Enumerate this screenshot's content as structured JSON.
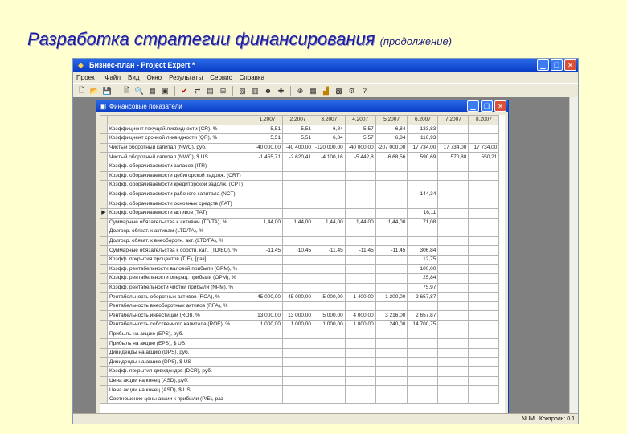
{
  "slide": {
    "title": "Разработка стратегии финансирования",
    "subtitle": "(продолжение)"
  },
  "app": {
    "title": "Бизнес-план - Project Expert *",
    "menu": [
      "Проект",
      "Файл",
      "Вид",
      "Окно",
      "Результаты",
      "Сервис",
      "Справка"
    ],
    "status_right": [
      "NUM",
      "Контроль: 0.1"
    ]
  },
  "child": {
    "title": "Финансовые показатели"
  },
  "grid": {
    "columns": [
      "1.2007",
      "2.2007",
      "3.2007",
      "4.2007",
      "5.2007",
      "6.2007",
      "7.2007",
      "8.2007"
    ],
    "rows": [
      {
        "label": "Коэффициент текущей ликвидности (CR), %",
        "values": [
          "5,51",
          "5,51",
          "6,84",
          "5,57",
          "6,84",
          "133,83",
          "",
          ""
        ]
      },
      {
        "label": "Коэффициент срочной ликвидности (QR), %",
        "values": [
          "5,51",
          "5,51",
          "6,84",
          "5,57",
          "6,84",
          "116,93",
          "",
          ""
        ]
      },
      {
        "label": "Чистый оборотный капитал (NWC), руб.",
        "values": [
          "-40 000,00",
          "-40 400,00",
          "-120 000,00",
          "-40 000,00",
          "-207 000,00",
          "17 734,00",
          "17 734,00",
          "17 734,00"
        ]
      },
      {
        "label": "Чистый оборотный капитал (NWC), $ US",
        "values": [
          "-1 455,71",
          "-2 620,41",
          "-4 100,16",
          "-5 442,8",
          "-6 68,56",
          "590,69",
          "570,88",
          "550,21"
        ]
      },
      {
        "label": "Коэфф. оборачиваемости запасов (ITR)",
        "values": [
          "",
          "",
          "",
          "",
          "",
          "",
          "",
          ""
        ]
      },
      {
        "label": "Коэфф. оборачиваемости дебиторской задолж. (CRT)",
        "values": [
          "",
          "",
          "",
          "",
          "",
          "",
          "",
          ""
        ]
      },
      {
        "label": "Коэфф. оборачиваемости кредиторской задолж. (CPT)",
        "values": [
          "",
          "",
          "",
          "",
          "",
          "",
          "",
          ""
        ]
      },
      {
        "label": "Коэфф. оборачиваемости рабочего капитала (NCT)",
        "values": [
          "",
          "",
          "",
          "",
          "",
          "144,34",
          "",
          ""
        ]
      },
      {
        "label": "Коэфф. оборачиваемости основных средств (FAT)",
        "values": [
          "",
          "",
          "",
          "",
          "",
          "",
          "",
          ""
        ]
      },
      {
        "label": "Коэфф. оборачиваемости активов (TAT)",
        "values": [
          "",
          "",
          "",
          "",
          "",
          "16,11",
          "",
          ""
        ],
        "indicator": "▶"
      },
      {
        "label": "Суммарные обязательства к активам (TD/TA), %",
        "values": [
          "1,44,00",
          "1,44,00",
          "1,44,00",
          "1,44,00",
          "1,44,00",
          "71,08",
          "",
          ""
        ]
      },
      {
        "label": "Долгоср. обязат. к активам (LTD/TA), %",
        "values": [
          "",
          "",
          "",
          "",
          "",
          "",
          "",
          ""
        ]
      },
      {
        "label": "Долгоср. обязат. к внеоборотн. акт. (LTD/FA), %",
        "values": [
          "",
          "",
          "",
          "",
          "",
          "",
          "",
          ""
        ]
      },
      {
        "label": "Суммарные обязательства к собств. кап. (TD/EQ), %",
        "values": [
          "-11,45",
          "-10,45",
          "-11,45",
          "-11,45",
          "-11,45",
          "306,84",
          "",
          ""
        ]
      },
      {
        "label": "Коэфф. покрытия процентов (TIE), [раз]",
        "values": [
          "",
          "",
          "",
          "",
          "",
          "12,75",
          "",
          ""
        ]
      },
      {
        "label": "Коэфф. рентабельности валовой прибыли (GPM), %",
        "values": [
          "",
          "",
          "",
          "",
          "",
          "100,00",
          "",
          ""
        ]
      },
      {
        "label": "Коэфф. рентабельности операц. прибыли (OPM), %",
        "values": [
          "",
          "",
          "",
          "",
          "",
          "25,84",
          "",
          ""
        ]
      },
      {
        "label": "Коэфф. рентабельности чистой прибыли (NPM), %",
        "values": [
          "",
          "",
          "",
          "",
          "",
          "75,97",
          "",
          ""
        ]
      },
      {
        "label": "Рентабельность оборотных активов (RCA), %",
        "values": [
          "-45 000,00",
          "-45 000,00",
          "-5 000,00",
          "-1 400,00",
          "-1 200,00",
          "2 657,87",
          "",
          ""
        ]
      },
      {
        "label": "Рентабельность внеоборотных активов (RFA), %",
        "values": [
          "",
          "",
          "",
          "",
          "",
          "",
          "",
          ""
        ]
      },
      {
        "label": "Рентабельность инвестиций (ROI), %",
        "values": [
          "13 000,00",
          "13 000,00",
          "5 000,00",
          "4 000,00",
          "3 216,00",
          "2 657,87",
          "",
          ""
        ]
      },
      {
        "label": "Рентабельность собственного капитала (ROE), %",
        "values": [
          "1 000,00",
          "1 000,00",
          "1 000,00",
          "1 000,00",
          "240,00",
          "14 700,75",
          "",
          ""
        ]
      },
      {
        "label": "Прибыль на акцию (EPS), руб.",
        "values": [
          "",
          "",
          "",
          "",
          "",
          "",
          "",
          ""
        ]
      },
      {
        "label": "Прибыль на акцию (EPS), $ US",
        "values": [
          "",
          "",
          "",
          "",
          "",
          "",
          "",
          ""
        ]
      },
      {
        "label": "Дивиденды на акцию (DPS), руб.",
        "values": [
          "",
          "",
          "",
          "",
          "",
          "",
          "",
          ""
        ]
      },
      {
        "label": "Дивиденды на акцию (DPS), $ US",
        "values": [
          "",
          "",
          "",
          "",
          "",
          "",
          "",
          ""
        ]
      },
      {
        "label": "Коэфф. покрытия дивидендов (DCR), руб.",
        "values": [
          "",
          "",
          "",
          "",
          "",
          "",
          "",
          ""
        ]
      },
      {
        "label": "Цена акции на конец (ASD), руб.",
        "values": [
          "",
          "",
          "",
          "",
          "",
          "",
          "",
          ""
        ]
      },
      {
        "label": "Цена акции на конец (ASD), $ US",
        "values": [
          "",
          "",
          "",
          "",
          "",
          "",
          "",
          ""
        ]
      },
      {
        "label": "Соотношение цены акции к прибыли (P/E), раз",
        "values": [
          "",
          "",
          "",
          "",
          "",
          "",
          "",
          ""
        ]
      }
    ]
  }
}
